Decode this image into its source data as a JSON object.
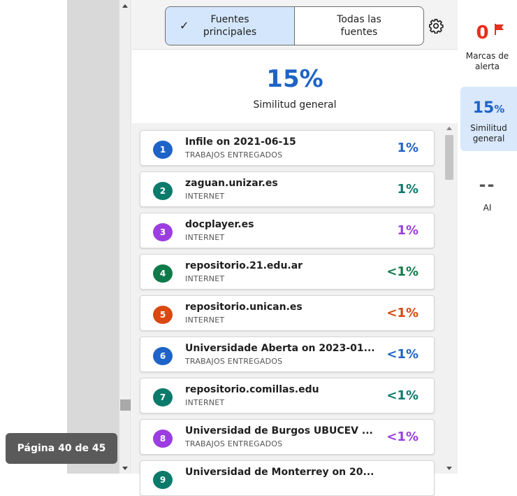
{
  "viewer": {
    "page_indicator": "Página 40 de 45"
  },
  "filter": {
    "options": [
      {
        "label": "Fuentes\nprincipales",
        "selected": true
      },
      {
        "label": "Todas las\nfuentes",
        "selected": false
      }
    ],
    "settings_icon": "gear-icon"
  },
  "summary": {
    "percent": "15%",
    "label": "Similitud general"
  },
  "sources": [
    {
      "number": "1",
      "name": "Infile on 2021-06-15",
      "type": "TRABAJOS ENTREGADOS",
      "percent": "1%",
      "color": "#1e63c7"
    },
    {
      "number": "2",
      "name": "zaguan.unizar.es",
      "type": "INTERNET",
      "percent": "1%",
      "color": "#0a7a6b"
    },
    {
      "number": "3",
      "name": "docplayer.es",
      "type": "INTERNET",
      "percent": "1%",
      "color": "#9b3de0"
    },
    {
      "number": "4",
      "name": "repositorio.21.edu.ar",
      "type": "INTERNET",
      "percent": "<1%",
      "color": "#0e7a4a"
    },
    {
      "number": "5",
      "name": "repositorio.unican.es",
      "type": "INTERNET",
      "percent": "<1%",
      "color": "#d9480f"
    },
    {
      "number": "6",
      "name": "Universidade Aberta on 2023-01...",
      "type": "TRABAJOS ENTREGADOS",
      "percent": "<1%",
      "color": "#1e63c7"
    },
    {
      "number": "7",
      "name": "repositorio.comillas.edu",
      "type": "INTERNET",
      "percent": "<1%",
      "color": "#0a7a6b"
    },
    {
      "number": "8",
      "name": "Universidad de Burgos UBUCEV ...",
      "type": "TRABAJOS ENTREGADOS",
      "percent": "<1%",
      "color": "#9b3de0"
    },
    {
      "number": "9",
      "name": "Universidad de Monterrey on 20...",
      "type": "",
      "percent": "",
      "color": "#0a7a6b"
    }
  ],
  "rail": {
    "flags_count": "0",
    "flags_label": "Marcas de alerta",
    "flag_color": "#e5301a",
    "similarity_value": "15",
    "similarity_unit": "%",
    "similarity_label": "Similitud general",
    "ai_value": "--",
    "ai_label": "AI"
  }
}
